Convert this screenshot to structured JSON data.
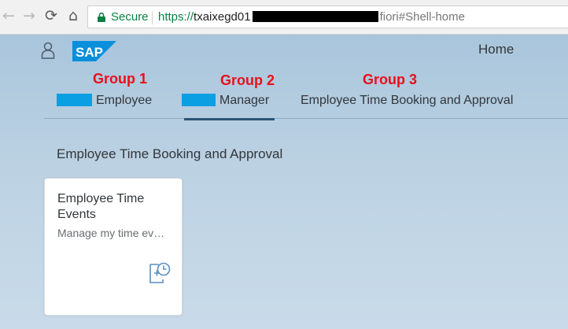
{
  "browser": {
    "nav": {
      "back": "←",
      "forward": "→",
      "reload": "⟳",
      "home": "⌂"
    },
    "secure_label": "Secure",
    "url_scheme": "https://",
    "url_host": "txaixegd01",
    "url_tail": "fiori#Shell-home"
  },
  "shell": {
    "logo": "SAP",
    "title": "Home"
  },
  "annotations": [
    "Group 1",
    "Group 2",
    "Group 3"
  ],
  "tabs": [
    {
      "label": "Employee",
      "selected": false
    },
    {
      "label": "Manager",
      "selected": true
    },
    {
      "label": "Employee Time Booking and Approval",
      "selected": false
    }
  ],
  "section": {
    "title": "Employee Time Booking and Approval"
  },
  "tile": {
    "title": "Employee Time Events",
    "subtitle": "Manage my time ev…",
    "icon": "time-entry-icon"
  },
  "colors": {
    "annotation": "#e8101a",
    "swatch": "#0a9fe3",
    "secure": "#0b8043",
    "sap_blue": "#0a8fdc"
  }
}
